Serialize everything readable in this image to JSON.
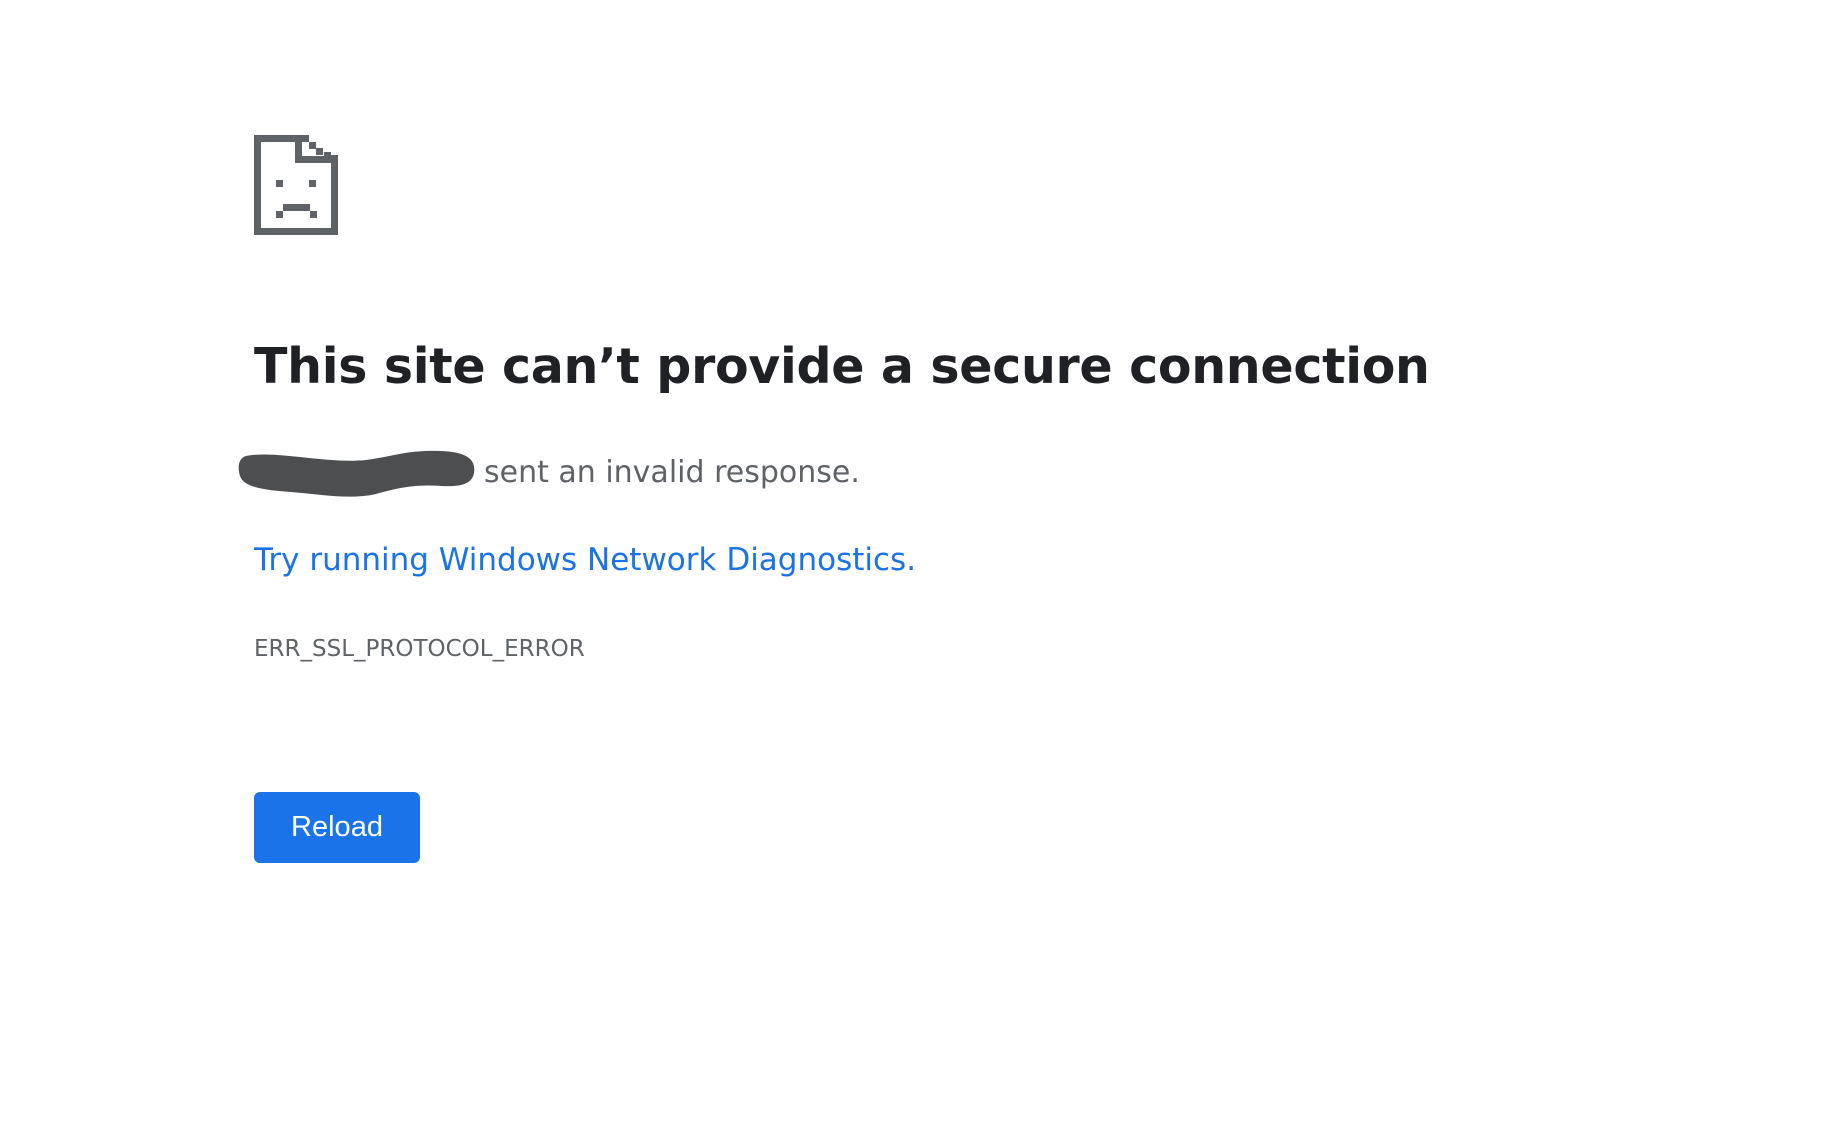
{
  "error_page": {
    "icon": "sad-document-icon",
    "title": "This site can’t provide a secure connection",
    "description_suffix": "sent an invalid response.",
    "diagnostics_link": "Try running Windows Network Diagnostics.",
    "error_code": "ERR_SSL_PROTOCOL_ERROR",
    "reload_label": "Reload"
  },
  "colors": {
    "background": "#ffffff",
    "title": "#202124",
    "secondary_text": "#5f6368",
    "link": "#1a73e8",
    "button": "#1a73e8",
    "icon": "#5f6368",
    "redaction": "#4d4e50"
  }
}
